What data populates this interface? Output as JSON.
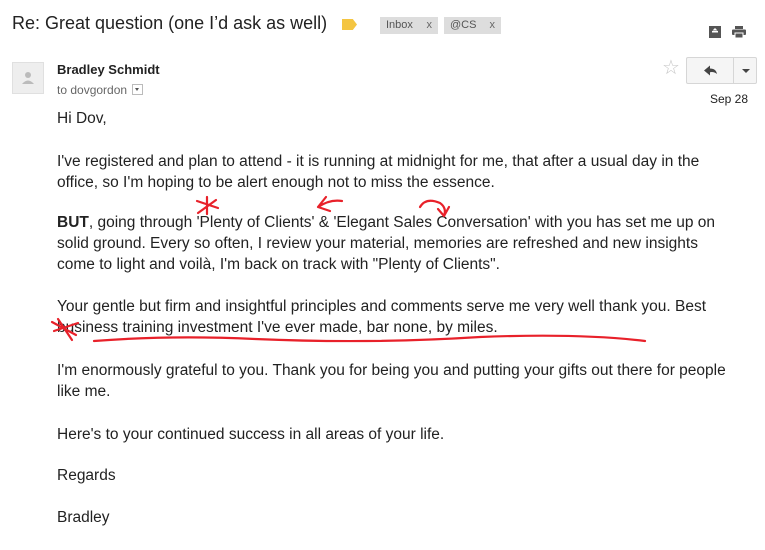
{
  "header": {
    "subject": "Re: Great question (one I’d ask as well)",
    "labels": [
      {
        "name": "Inbox",
        "close": "x"
      },
      {
        "name": "@CS",
        "close": "x"
      }
    ]
  },
  "message": {
    "sender": "Bradley Schmidt",
    "to_line": "to dovgordon",
    "date": "Sep 28",
    "body": {
      "greeting": "Hi Dov,",
      "p1": "I've registered and plan to attend - it is running at midnight for me, that after a usual day in the office, so I'm hoping to be alert enough not to miss the essence.",
      "p2_bold": "BUT",
      "p2_rest": ", going through 'Plenty of Clients' & 'Elegant Sales Conversation' with you has set me up on solid ground. Every so often, I review your material, memories are refreshed and new insights come to light and voilà, I'm back on track with \"Plenty of Clients\".",
      "p3_start": "Your gentle but firm and insightful principles and comments serve me very well thank you. ",
      "p3_highlight": "Best business training investment I've ever made, bar none, by miles.",
      "p4": "I'm enormously grateful to you. Thank you for being you and putting your gifts out there for people like me.",
      "p5": "Here's to your continued success in all areas of your life.",
      "closing": "Regards",
      "signature": "Bradley"
    }
  },
  "colors": {
    "annotation": "#e8212a",
    "importance_marker": "#f4c542",
    "label_chip": "#dddddd"
  },
  "icons": [
    "importance-marker-icon",
    "print-all-icon",
    "print-icon",
    "star-icon",
    "reply-icon",
    "chevron-down-icon"
  ]
}
